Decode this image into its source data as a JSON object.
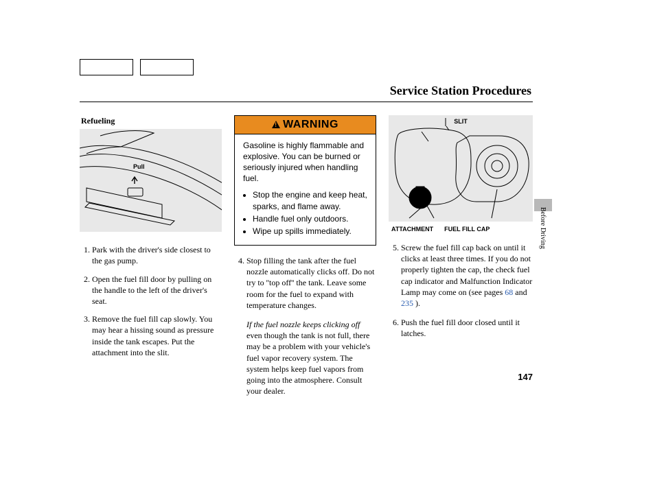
{
  "page": {
    "title": "Service Station Procedures",
    "section_tab": "Before Driving",
    "page_number": "147"
  },
  "col1": {
    "subhead": "Refueling",
    "fig_label": "Pull",
    "steps": [
      "Park with the driver's side closest to the gas pump.",
      "Open the fuel fill door by pulling on the handle to the left of the driver's seat.",
      "Remove the fuel fill cap slowly. You may hear a hissing sound as pressure inside the tank escapes. Put the attachment into the slit."
    ]
  },
  "warning": {
    "header": "WARNING",
    "intro": "Gasoline is highly flammable and explosive. You can be burned or seriously injured when handling fuel.",
    "bullets": [
      "Stop the engine and keep heat, sparks, and flame away.",
      "Handle fuel only outdoors.",
      "Wipe up spills immediately."
    ]
  },
  "col2": {
    "step4": "Stop filling the tank after the fuel nozzle automatically clicks off. Do not try to ''top off'' the tank. Leave some room for the fuel to expand with temperature changes.",
    "nozzle_lead_italic": "If the fuel nozzle keeps clicking off",
    "nozzle_rest": "even though the tank is not full, there may be a problem with your vehicle's fuel vapor recovery system. The system helps keep fuel vapors from going into the atmosphere. Consult your dealer."
  },
  "col3": {
    "fig_top_label": "SLIT",
    "fig_labels": [
      "ATTACHMENT",
      "FUEL FILL CAP"
    ],
    "step5_lead": "Screw the fuel fill cap back on until it clicks at least three times. If you do not properly tighten the cap, the check fuel cap indicator and Malfunction Indicator Lamp may come on (see pages ",
    "page_link_1": "68",
    "mid": " and ",
    "page_link_2": "235",
    "tail": " ).",
    "step6": "Push the fuel fill door closed until it latches."
  }
}
